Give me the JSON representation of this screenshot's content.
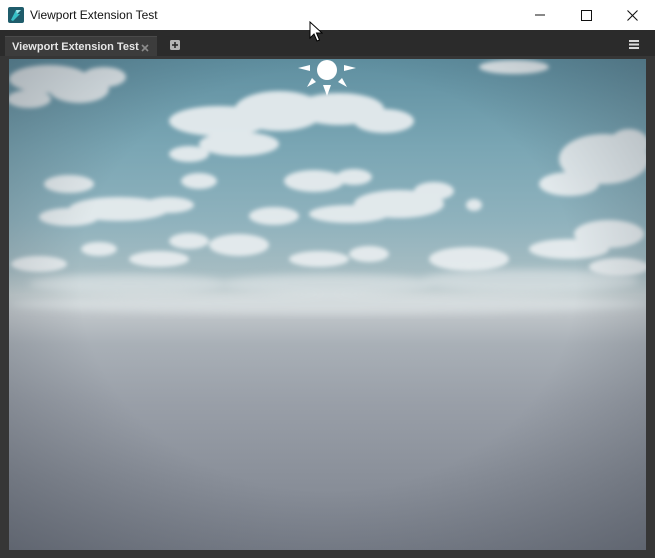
{
  "window": {
    "title": "Viewport Extension Test",
    "app_icon": "app-logo-icon",
    "controls": {
      "minimize_icon": "minimize-icon",
      "maximize_icon": "maximize-icon",
      "close_icon": "close-icon"
    }
  },
  "tabs": [
    {
      "label": "Viewport Extension Test",
      "active": true,
      "close_icon": "close-tab-icon"
    }
  ],
  "tabbar": {
    "add_tab_icon": "add-tab-icon",
    "menu_icon": "hamburger-menu-icon"
  },
  "viewport": {
    "scene": "sky-with-clouds-over-fog",
    "sun_icon": "sun-light-gizmo-icon",
    "colors": {
      "sky_top": "#5f8fa0",
      "horizon": "#c4cfd1",
      "ground": "#7d838e"
    }
  },
  "cursor": "mouse-pointer-icon"
}
